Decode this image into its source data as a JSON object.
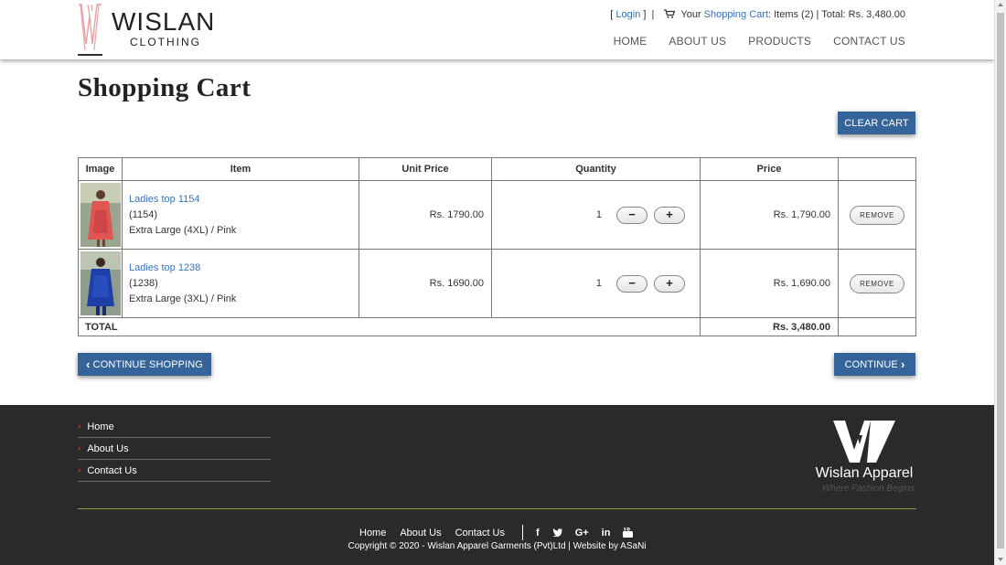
{
  "header": {
    "brand": "WISLAN",
    "brand_sub": "CLOTHING",
    "login_label": "Login",
    "cart_prefix": "Your",
    "cart_link": "Shopping Cart",
    "cart_summary": ": Items (2) | Total: Rs. 3,480.00",
    "nav": [
      "HOME",
      "ABOUT US",
      "PRODUCTS",
      "CONTACT US"
    ]
  },
  "page": {
    "title": "Shopping Cart",
    "clear_cart_label": "CLEAR CART"
  },
  "table": {
    "headers": [
      "Image",
      "Item",
      "Unit Price",
      "Quantity",
      "Price",
      ""
    ],
    "rows": [
      {
        "name": "Ladies top 1154",
        "code": "(1154)",
        "variant": "Extra Large (4XL) / Pink",
        "unit_price": "Rs. 1790.00",
        "qty": "1",
        "price": "Rs. 1,790.00",
        "remove": "REMOVE"
      },
      {
        "name": "Ladies top 1238",
        "code": "(1238)",
        "variant": "Extra Large (3XL) / Pink",
        "unit_price": "Rs. 1690.00",
        "qty": "1",
        "price": "Rs. 1,690.00",
        "remove": "REMOVE"
      }
    ],
    "total_label": "TOTAL",
    "total_value": "Rs. 3,480.00",
    "minus": "−",
    "plus": "+"
  },
  "actions": {
    "continue_shopping": "CONTINUE SHOPPING",
    "continue": "CONTINUE"
  },
  "footer": {
    "links": [
      "Home",
      "About Us",
      "Contact Us"
    ],
    "logo_text": "Wislan Apparel",
    "logo_tagline": "Where Fashion Begins",
    "bottom_nav": [
      "Home",
      "About Us",
      "Contact Us"
    ],
    "social": [
      "facebook-icon",
      "twitter-icon",
      "google-plus-icon",
      "linkedin-icon",
      "youtube-icon"
    ],
    "copyright": "Copyright © 2020 - Wislan Apparel Garments (Pvt)Ltd  |  Website by ASaNi"
  },
  "colors": {
    "accent": "#35649b",
    "link": "#3a73b5",
    "footer_bg": "#2a2a2a",
    "footer_line": "#8aa036",
    "logo_pink": "#e8a0a4"
  }
}
